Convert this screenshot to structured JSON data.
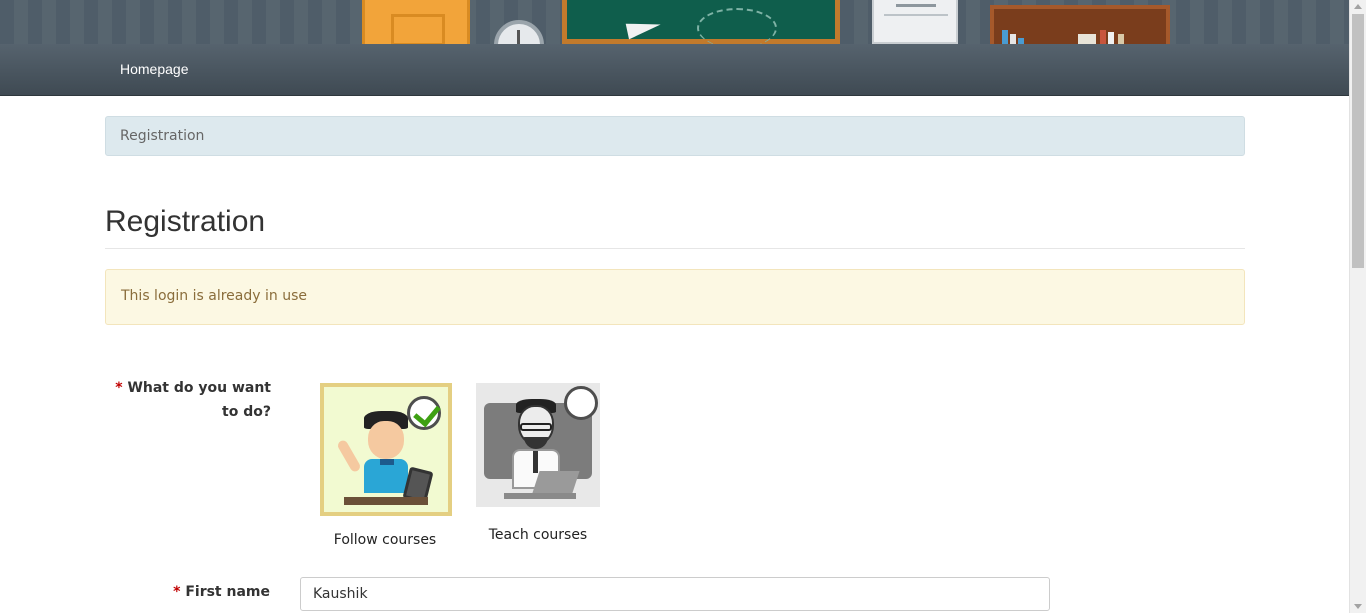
{
  "nav": {
    "home_label": "Homepage"
  },
  "breadcrumb": {
    "current": "Registration"
  },
  "page": {
    "title": "Registration"
  },
  "alert": {
    "message": "This login is already in use",
    "type": "warning"
  },
  "form": {
    "role_question": {
      "required_mark": "*",
      "label": "What do you want to do?"
    },
    "role_options": [
      {
        "label": "Follow courses",
        "selected": true
      },
      {
        "label": "Teach courses",
        "selected": false
      }
    ],
    "first_name": {
      "required_mark": "*",
      "label": "First name",
      "value": "Kaushik"
    }
  },
  "colors": {
    "navbar": "#46525c",
    "breadcrumb_bg": "#dde9ee",
    "alert_bg": "#fcf8e3",
    "alert_text": "#8a6d3b",
    "required": "#c00000",
    "selected_border": "#e4cf82",
    "check": "#3ea012"
  },
  "icons": {
    "selected_badge": "check-circle-icon",
    "unselected_badge": "empty-circle-icon"
  }
}
